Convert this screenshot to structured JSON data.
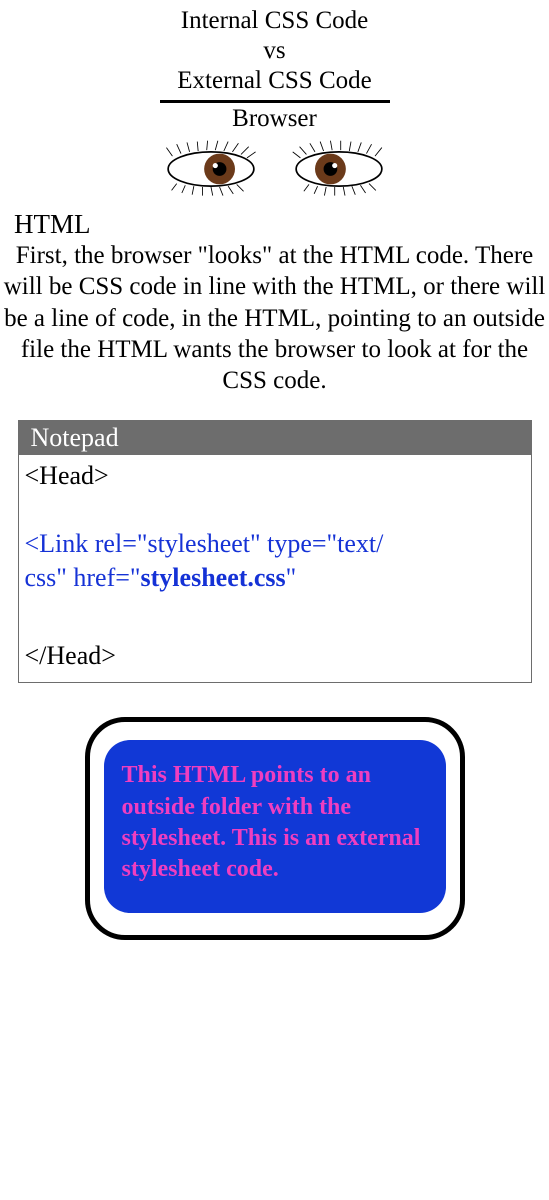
{
  "title": {
    "line1": "Internal CSS Code",
    "line2": "vs",
    "line3": "External CSS Code",
    "subtitle": "Browser"
  },
  "html_label": "HTML",
  "paragraph": "First, the browser \"looks\" at the HTML code. There will be CSS code in line with the HTML, or there will be a line of code, in the HTML, pointing to an outside file the HTML wants the browser to look at for the CSS code.",
  "notepad": {
    "title": "Notepad",
    "code_head_open": "<Head>",
    "code_link_part1": "<Link rel=\"stylesheet\" type=\"text/",
    "code_link_part2": "css\" href=\"",
    "code_link_bold": "stylesheet.css",
    "code_link_part3": "\"",
    "code_head_close": "</Head>"
  },
  "callout": {
    "text": "This HTML points to an outside folder with the stylesheet. This is an external stylesheet code."
  }
}
